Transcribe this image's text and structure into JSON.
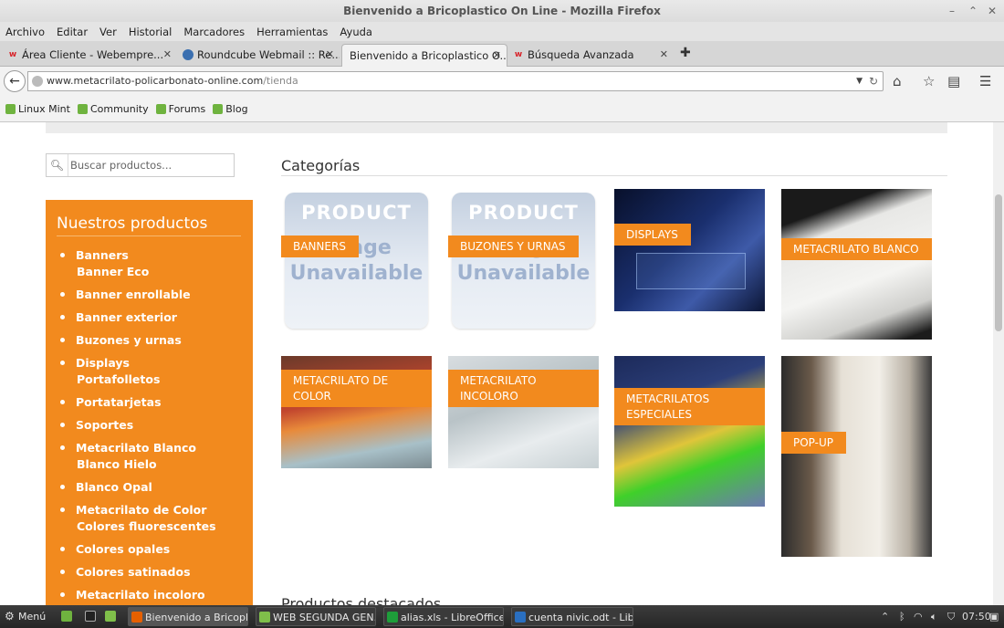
{
  "window": {
    "title": "Bienvenido a Bricoplastico On Line - Mozilla Firefox"
  },
  "menu": [
    "Archivo",
    "Editar",
    "Ver",
    "Historial",
    "Marcadores",
    "Herramientas",
    "Ayuda"
  ],
  "tabs": [
    {
      "label": "Área Cliente - Webempre...",
      "icon": "webempresa-icon"
    },
    {
      "label": "Roundcube Webmail :: Re...",
      "icon": "roundcube-icon"
    },
    {
      "label": "Bienvenido a Bricoplastico O...",
      "icon": "none",
      "active": true
    },
    {
      "label": "Búsqueda Avanzada",
      "icon": "webempresa-icon"
    }
  ],
  "url": {
    "host": "www.metacrilato-policarbonato-online.com",
    "path": "/tienda"
  },
  "bookmarks": [
    "Linux Mint",
    "Community",
    "Forums",
    "Blog"
  ],
  "search": {
    "placeholder": "Buscar productos..."
  },
  "sidebar": {
    "title": "Nuestros productos",
    "items": [
      {
        "label": "Banners",
        "bullet": true
      },
      {
        "label": "Banner Eco",
        "bullet": false
      },
      {
        "label": "Banner enrollable",
        "bullet": true
      },
      {
        "label": "Banner exterior",
        "bullet": true
      },
      {
        "label": "Buzones y urnas",
        "bullet": true
      },
      {
        "label": "Displays",
        "bullet": true
      },
      {
        "label": "Portafolletos",
        "bullet": false
      },
      {
        "label": "Portatarjetas",
        "bullet": true
      },
      {
        "label": "Soportes",
        "bullet": true
      },
      {
        "label": "Metacrilato Blanco",
        "bullet": true
      },
      {
        "label": "Blanco Hielo",
        "bullet": false
      },
      {
        "label": "Blanco Opal",
        "bullet": true
      },
      {
        "label": "Metacrilato de Color",
        "bullet": true
      },
      {
        "label": "Colores fluorescentes",
        "bullet": false
      },
      {
        "label": "Colores opales",
        "bullet": true
      },
      {
        "label": "Colores satinados",
        "bullet": true
      },
      {
        "label": "Metacrilato incoloro",
        "bullet": true
      }
    ]
  },
  "categories": {
    "heading": "Categorías",
    "placeholder": {
      "line1": "PRODUCT",
      "line2": "Image",
      "line3": "Unavailable"
    },
    "items": [
      {
        "label": "BANNERS"
      },
      {
        "label": "BUZONES Y URNAS"
      },
      {
        "label": "DISPLAYS"
      },
      {
        "label": "METACRILATO BLANCO"
      },
      {
        "label": "METACRILATO DE COLOR"
      },
      {
        "label": "METACRILATO INCOLORO"
      },
      {
        "label": "METACRILATOS ESPECIALES"
      },
      {
        "label": "POP-UP"
      }
    ]
  },
  "featured": {
    "heading": "Productos destacados"
  },
  "taskbar": {
    "menu_label": "Menú",
    "windows": [
      "Bienvenido a Bricopl...",
      "WEB SEGUNDA GEN...",
      "alias.xls - LibreOffice ...",
      "cuenta nivic.odt - Libr..."
    ],
    "clock": "07:50"
  },
  "colors": {
    "accent": "#f28a1e"
  }
}
